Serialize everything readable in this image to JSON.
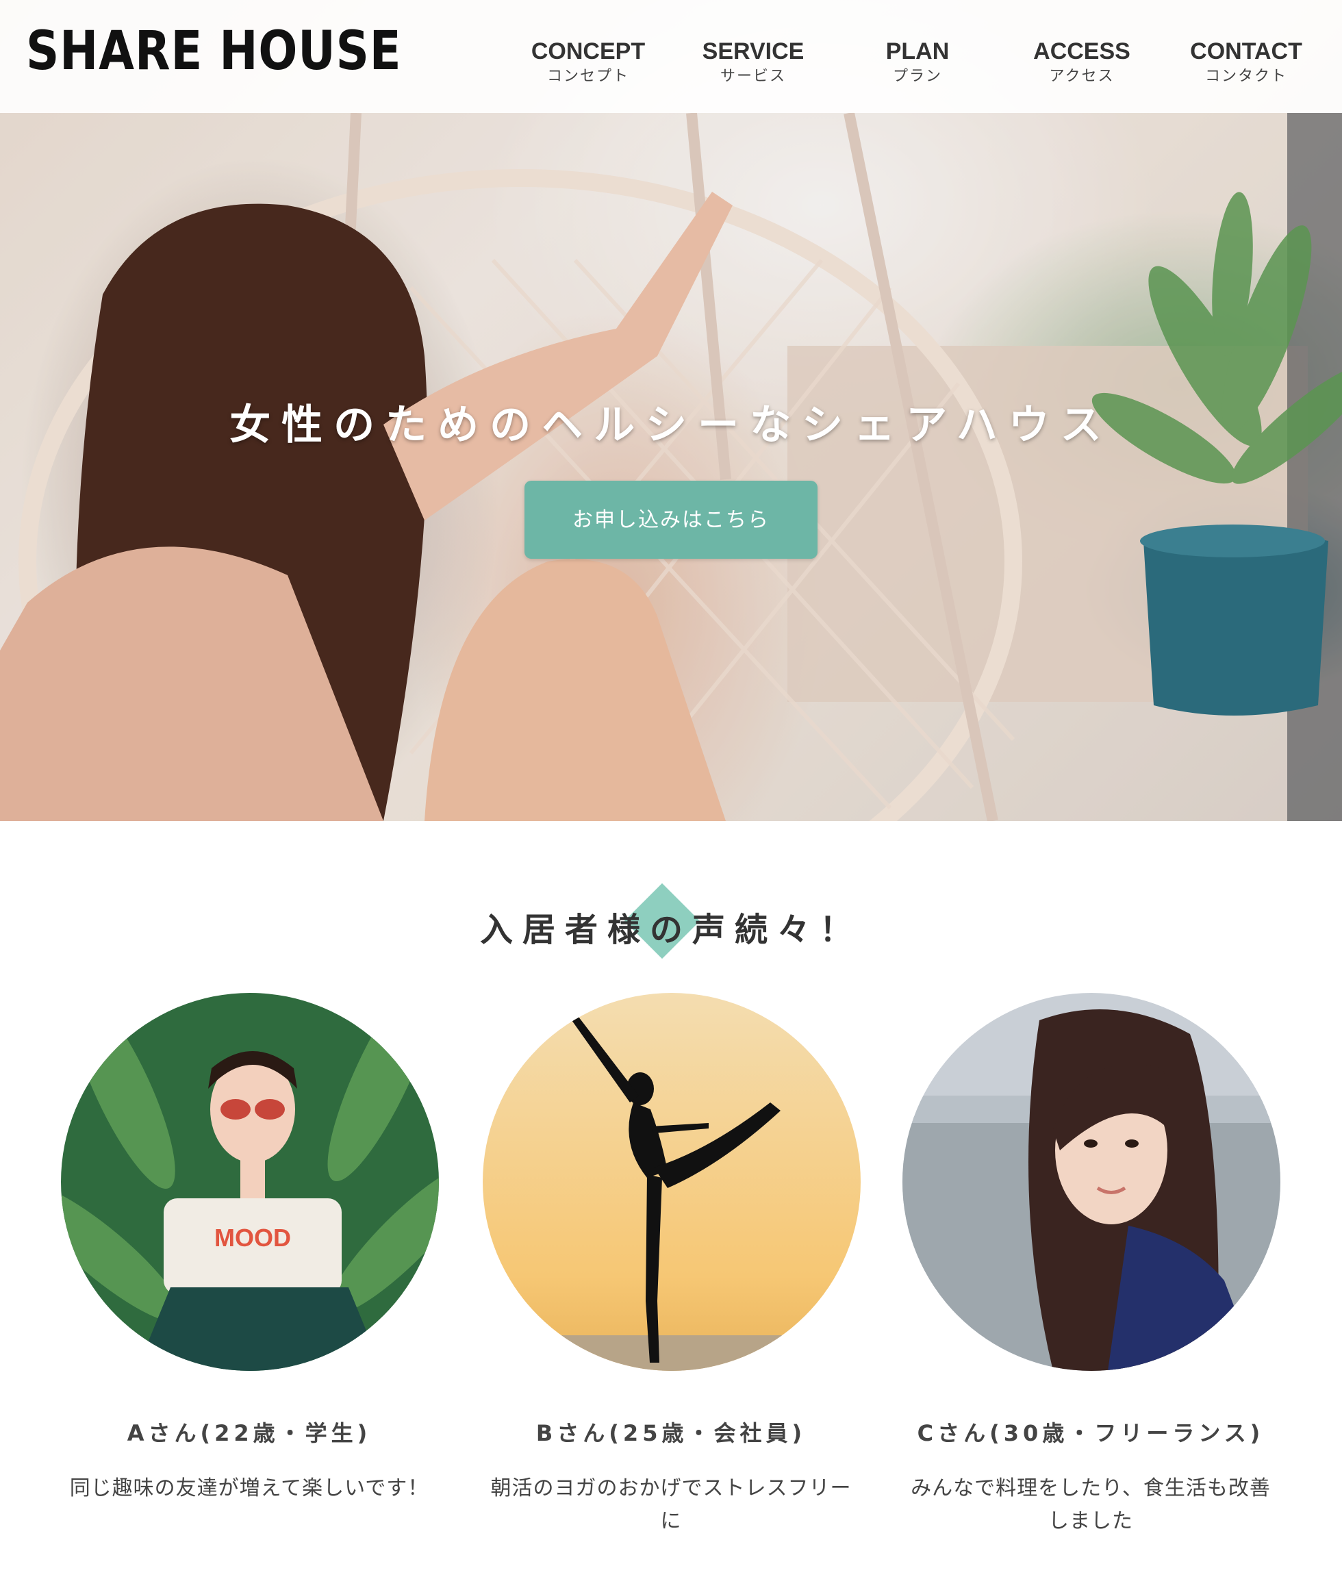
{
  "header": {
    "logo": "SHARE HOUSE",
    "nav": [
      {
        "en": "CONCEPT",
        "jp": "コンセプト"
      },
      {
        "en": "SERVICE",
        "jp": "サービス"
      },
      {
        "en": "PLAN",
        "jp": "プラン"
      },
      {
        "en": "ACCESS",
        "jp": "アクセス"
      },
      {
        "en": "CONTACT",
        "jp": "コンタクト"
      }
    ]
  },
  "hero": {
    "title": "女性のためのヘルシーなシェアハウス",
    "cta_label": "お申し込みはこちら"
  },
  "testimonials": {
    "heading": "入居者様の声続々！",
    "items": [
      {
        "name": "Aさん(22歳・学生)",
        "comment": "同じ趣味の友達が増えて楽しいです！"
      },
      {
        "name": "Bさん(25歳・会社員)",
        "comment": "朝活のヨガのおかげでストレスフリーに"
      },
      {
        "name": "Cさん(30歳・フリーランス)",
        "comment": "みんなで料理をしたり、食生活も改善しました"
      }
    ]
  },
  "colors": {
    "accent": "#6db6a6",
    "diamond": "#8ecfbf",
    "text": "#333333"
  },
  "icons": {
    "hero_image": "woman-on-swing-photo",
    "avatar_a": "woman-in-sunglasses-photo",
    "avatar_b": "ballet-dancer-silhouette-photo",
    "avatar_c": "woman-by-sea-photo"
  }
}
